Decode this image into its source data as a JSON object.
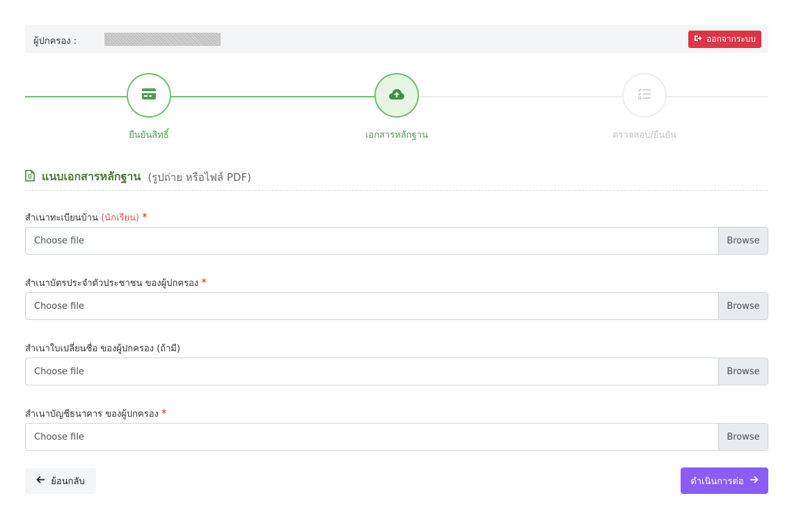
{
  "header": {
    "guardian_label": "ผู้ปกครอง :",
    "logout_label": "ออกจากระบบ",
    "logout_icon": "sign-out-icon"
  },
  "colors": {
    "step_done": "#6dbf6d",
    "step_active_bg": "#e6f6e1",
    "logout": "#dc3545",
    "primary": "#8b5cf6",
    "required": "#e0252a",
    "title": "#4c7a3a"
  },
  "steps": [
    {
      "label": "ยืนยันสิทธิ์",
      "state": "done",
      "icon": "credit-card-icon"
    },
    {
      "label": "เอกสารหลักฐาน",
      "state": "active",
      "icon": "cloud-upload-icon"
    },
    {
      "label": "ตรวจสอบ/ยืนยัน",
      "state": "pending",
      "icon": "tasks-list-icon"
    }
  ],
  "section": {
    "title": "แนบเอกสารหลักฐาน",
    "subtitle": "(รูปถ่าย หรือไฟล์ PDF)",
    "icon": "file-icon"
  },
  "fields": [
    {
      "label": "สำเนาทะเบียนบ้าน",
      "note": "(นักเรียน)",
      "required": "*",
      "placeholder": "Choose file",
      "browse": "Browse"
    },
    {
      "label": "สำเนาบัตรประจำตัวประชาชน ของผู้ปกครอง",
      "note": "",
      "required": "*",
      "placeholder": "Choose file",
      "browse": "Browse"
    },
    {
      "label": "สำเนาใบเปลี่ยนชื่อ ของผู้ปกครอง (ถ้ามี)",
      "note": "",
      "required": "",
      "placeholder": "Choose file",
      "browse": "Browse"
    },
    {
      "label": "สำเนาบัญชีธนาคาร ของผู้ปกครอง",
      "note": "",
      "required": "*",
      "placeholder": "Choose file",
      "browse": "Browse"
    }
  ],
  "actions": {
    "back_label": "ย้อนกลับ",
    "next_label": "ดำเนินการต่อ"
  }
}
